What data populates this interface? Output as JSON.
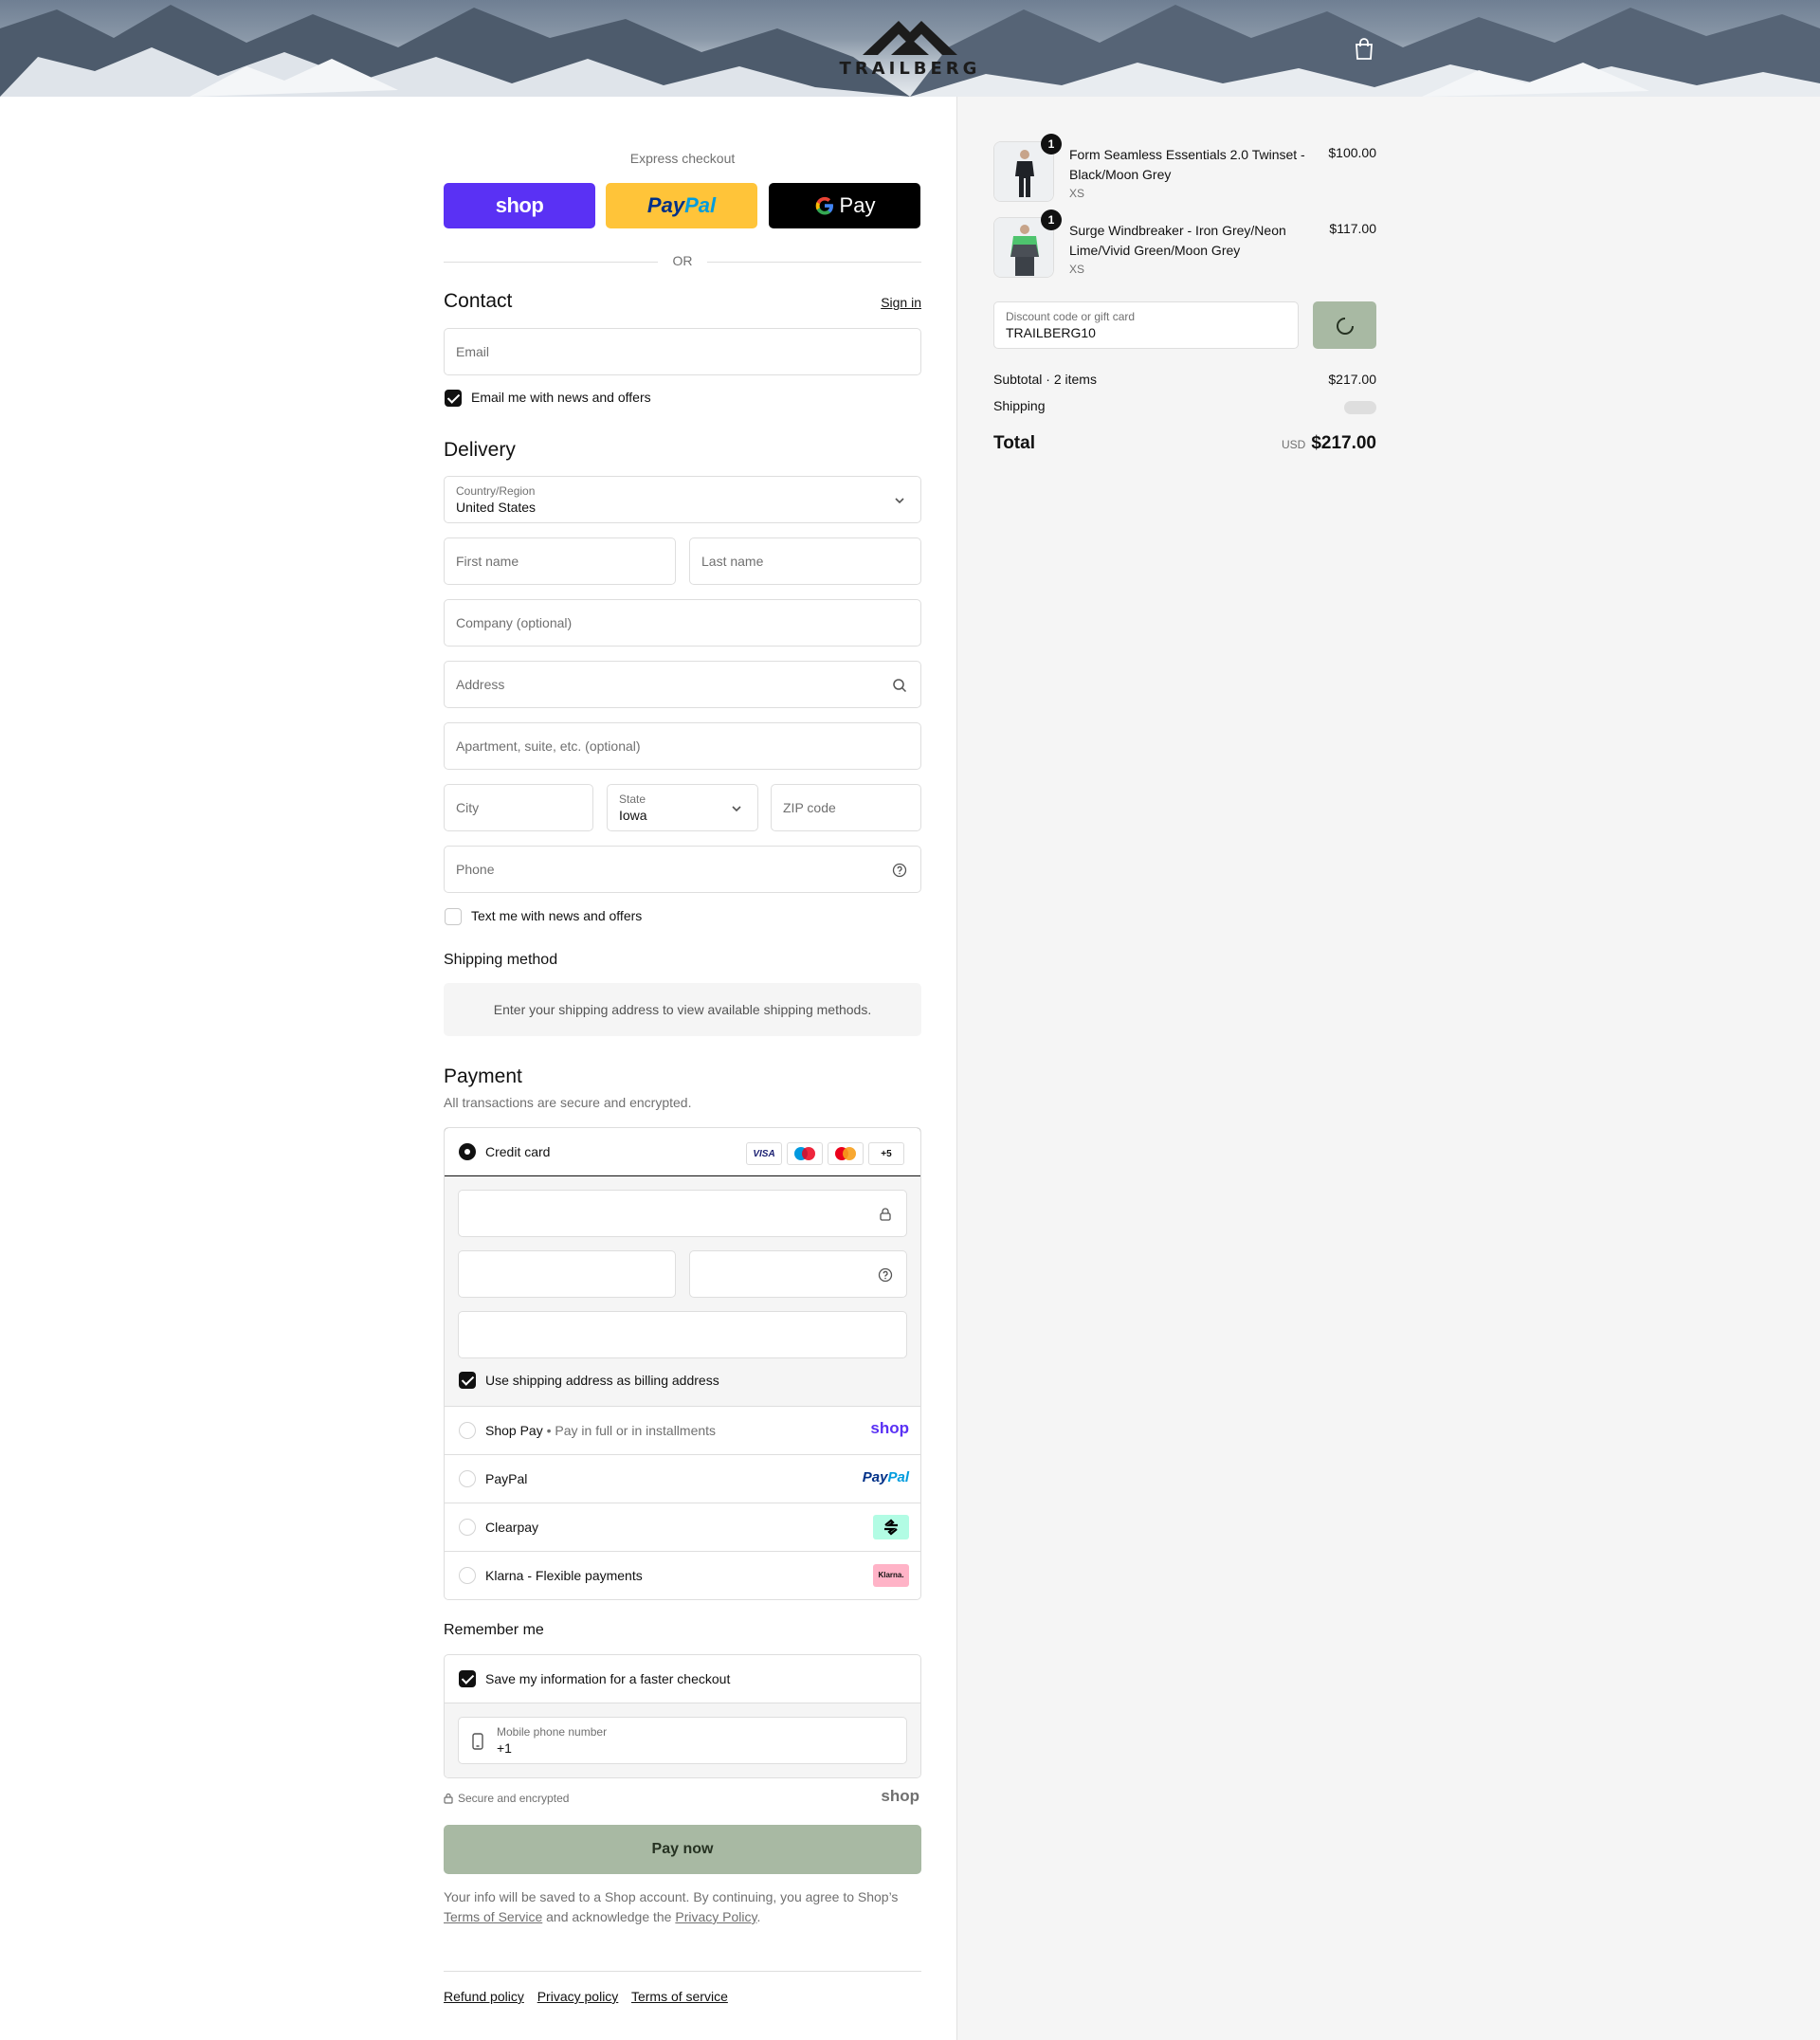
{
  "brand": {
    "name": "TRAILBERG"
  },
  "express": {
    "title": "Express checkout",
    "shop_label": "shop",
    "paypal_label_1": "Pay",
    "paypal_label_2": "Pal",
    "gpay_label": "Pay",
    "or_label": "OR"
  },
  "contact": {
    "heading": "Contact",
    "sign_in": "Sign in",
    "email_placeholder": "Email",
    "news_label": "Email me with news and offers",
    "news_checked": true
  },
  "delivery": {
    "heading": "Delivery",
    "country_label": "Country/Region",
    "country_value": "United States",
    "first_name_placeholder": "First name",
    "last_name_placeholder": "Last name",
    "company_placeholder": "Company (optional)",
    "address_placeholder": "Address",
    "apartment_placeholder": "Apartment, suite, etc. (optional)",
    "city_placeholder": "City",
    "state_label": "State",
    "state_value": "Iowa",
    "zip_placeholder": "ZIP code",
    "phone_placeholder": "Phone",
    "sms_label": "Text me with news and offers",
    "sms_checked": false
  },
  "shipping_method": {
    "heading": "Shipping method",
    "notice": "Enter your shipping address to view available shipping methods."
  },
  "payment": {
    "heading": "Payment",
    "subtitle": "All transactions are secure and encrypted.",
    "credit_card_label": "Credit card",
    "card_brands": [
      "VISA",
      "maestro",
      "mastercard",
      "+5"
    ],
    "billing_same_label": "Use shipping address as billing address",
    "billing_same_checked": true,
    "shop_pay_label": "Shop Pay",
    "shop_pay_sub": "Pay in full or in installments",
    "shop_pay_logo": "shop",
    "paypal_label": "PayPal",
    "paypal_logo_1": "Pay",
    "paypal_logo_2": "Pal",
    "clearpay_label": "Clearpay",
    "klarna_label": "Klarna - Flexible payments",
    "klarna_logo": "Klarna."
  },
  "remember": {
    "heading": "Remember me",
    "save_label": "Save my information for a faster checkout",
    "save_checked": true,
    "mobile_label": "Mobile phone number",
    "mobile_value": "+1",
    "secure_label": "Secure and encrypted",
    "shop_logo": "shop"
  },
  "pay_now_label": "Pay now",
  "legal": {
    "text_1": "Your info will be saved to a Shop account. By continuing, you agree to Shop’s",
    "terms_link": "Terms of Service",
    "text_2": "and acknowledge the",
    "privacy_link": "Privacy Policy",
    "text_3": "."
  },
  "footer_links": [
    "Refund policy",
    "Privacy policy",
    "Terms of service"
  ],
  "cart": {
    "items": [
      {
        "qty": "1",
        "name": "Form Seamless Essentials 2.0 Twinset - Black/Moon Grey",
        "variant": "XS",
        "price": "$100.00"
      },
      {
        "qty": "1",
        "name": "Surge Windbreaker - Iron Grey/Neon Lime/Vivid Green/Moon Grey",
        "variant": "XS",
        "price": "$117.00"
      }
    ],
    "discount_label": "Discount code or gift card",
    "discount_value": "TRAILBERG10",
    "subtotal_label": "Subtotal · 2 items",
    "subtotal_value": "$217.00",
    "shipping_label": "Shipping",
    "total_label": "Total",
    "currency": "USD",
    "total_value": "$217.00"
  },
  "colors": {
    "shop_purple": "#5a31f4",
    "paypal_yellow": "#ffc439",
    "pay_button": "#a8b9a3",
    "clearpay_mint": "#b2fce4",
    "klarna_pink": "#ffb3c7"
  }
}
